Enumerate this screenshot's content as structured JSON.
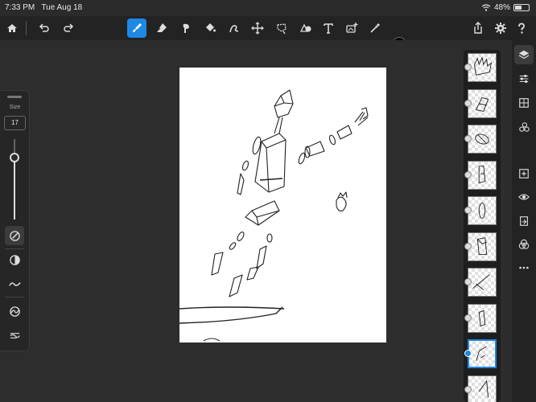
{
  "status": {
    "time": "7:33 PM",
    "date": "Tue Aug 18",
    "battery_text": "48%",
    "battery_level": 0.48
  },
  "toolbar": {
    "left_icons": [
      "home-icon",
      "undo-icon",
      "redo-icon"
    ],
    "tools": [
      "brush-icon",
      "eraser-icon",
      "smudge-icon",
      "fill-icon",
      "liquify-icon",
      "transform-icon",
      "lasso-icon",
      "shape-icon",
      "text-icon",
      "image-import-icon",
      "eyedropper-icon"
    ],
    "active_tool": "brush-icon",
    "color": "#000000",
    "right_icons": [
      "share-icon",
      "settings-icon",
      "help-icon"
    ]
  },
  "left_panel": {
    "size_label": "Size",
    "size_value": "17",
    "slider_level": 0.77,
    "tools": [
      "brush-settings-icon",
      "opacity-icon",
      "smoothing-icon",
      "pressure-icon",
      "blend-settings-icon"
    ]
  },
  "layers": {
    "count": 10,
    "selected_index": 8
  },
  "right_sidebar": {
    "icons": [
      "layers-icon",
      "adjustments-icon",
      "grid-icon",
      "layer-effects-icon",
      "add-layer-icon",
      "visibility-icon",
      "import-layer-icon",
      "blend-mode-icon",
      "more-icon"
    ]
  },
  "colors": {
    "accent": "#1e88e5",
    "toolbar_bg": "#232323",
    "canvas_bg": "#ffffff"
  }
}
